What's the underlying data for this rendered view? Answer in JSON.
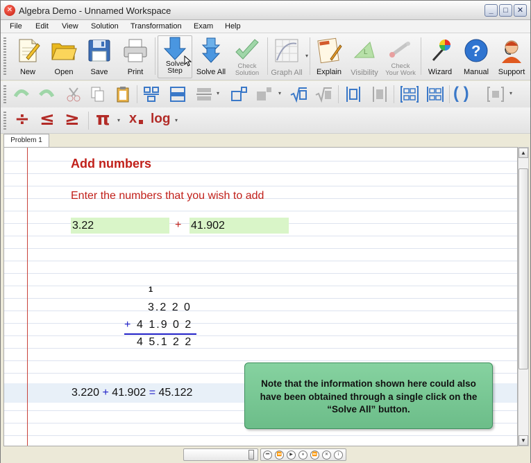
{
  "window": {
    "title": "Algebra Demo - Unnamed Workspace",
    "icon": "app-icon",
    "buttons": [
      "minimize-icon",
      "maximize-icon",
      "close-icon"
    ]
  },
  "menu": [
    "File",
    "Edit",
    "View",
    "Solution",
    "Transformation",
    "Exam",
    "Help"
  ],
  "toolbar": {
    "new": "New",
    "open": "Open",
    "save": "Save",
    "print": "Print",
    "solve_step_1": "Solve",
    "solve_step_2": "Step",
    "solve_all": "Solve All",
    "check_solution_1": "Check",
    "check_solution_2": "Solution",
    "graph_all": "Graph All",
    "explain": "Explain",
    "visibility": "Visibility",
    "check_work_1": "Check",
    "check_work_2": "Your Work",
    "wizard": "Wizard",
    "manual": "Manual",
    "support": "Support"
  },
  "symbols": {
    "divide": "÷",
    "le": "≤",
    "ge": "≥",
    "pi": "π",
    "x_sub": "x",
    "log": "log",
    "paren": "( )"
  },
  "tab": "Problem 1",
  "problem": {
    "heading": "Add numbers",
    "instruction": "Enter the numbers that you wish to add",
    "input_a": "3.22",
    "operator": "+",
    "input_b": "41.902",
    "carry": "1",
    "row1": "3.2 2 0",
    "row2_op": "+",
    "row2": "4 1.9 0 2",
    "row3": "4 5.1 2 2",
    "result_a": "3.220",
    "result_op": "+",
    "result_b": "41.902",
    "result_eq": "=",
    "result_c": "45.122"
  },
  "note": "Note that the information shown here could also have been obtained through a single click on the “Solve All” button.",
  "colors": {
    "accent_red": "#c1201a",
    "input_green": "#d9f5c8",
    "note_green": "#7cc896",
    "operator_blue": "#2121c8"
  }
}
